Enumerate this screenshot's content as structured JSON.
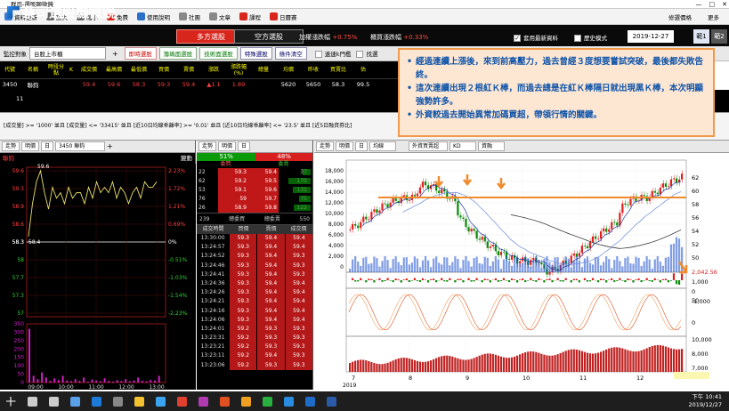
{
  "window": {
    "title": "群司-選股顯微鏡",
    "controls": [
      "—",
      "□",
      "✕"
    ]
  },
  "menu": [
    {
      "label": "資料更新",
      "icon": "refresh-icon",
      "color": "#3a7bd5"
    },
    {
      "label": "放大",
      "icon": "zoom-in-icon",
      "color": "#666666"
    },
    {
      "label": "縮小",
      "icon": "zoom-out-icon",
      "color": "#666666"
    },
    {
      "label": "免費",
      "icon": "free-badge-icon",
      "color": "#d9261c"
    },
    {
      "label": "使用說明",
      "icon": "help-icon",
      "color": "#2a6fc9"
    },
    {
      "label": "社團",
      "icon": "community-icon",
      "color": "#888888"
    },
    {
      "label": "文章",
      "icon": "article-icon",
      "color": "#888888"
    },
    {
      "label": "課程",
      "icon": "course-icon",
      "color": "#d9261c"
    },
    {
      "label": "日曆賽",
      "icon": "calendar-icon",
      "color": "#d9261c"
    }
  ],
  "menu_right": {
    "settings": "修選價格",
    "more": "更多"
  },
  "brand": {
    "name": "蔡司選股顯微鏡"
  },
  "mode_buttons": {
    "long": "多方選股",
    "short": "空方選股"
  },
  "stats": {
    "rise_label": "加權漲跌幅",
    "rise_value": "+0.75%",
    "counter_label": "櫃買漲跌幅",
    "counter_value": "+0.33%"
  },
  "options": {
    "latest_data": "套用最新資料",
    "history_mode": "歷史模式",
    "latest_checked": true,
    "history_checked": false
  },
  "date": "2019-12-27",
  "tabs": [
    "範1",
    "範2"
  ],
  "filter": {
    "label": "監控對象",
    "market": "台股上市櫃",
    "buttons": [
      {
        "label": "即時選股",
        "style": "red"
      },
      {
        "label": "籌碼面選股",
        "style": "green"
      },
      {
        "label": "技術面選股",
        "style": "green"
      },
      {
        "label": "特殊選股",
        "style": "blue"
      },
      {
        "label": "條件清空",
        "style": "blue"
      }
    ],
    "checks": [
      "速速k門檻",
      "找選"
    ]
  },
  "quote_table": {
    "headers": [
      "代號",
      "名稱",
      "時段分點",
      "K",
      "成交價",
      "最高價",
      "最低價",
      "買價",
      "賣價",
      "漲跌",
      "漲跌幅(%)",
      "總量",
      "均價",
      "昨收",
      "買賣比",
      "估"
    ],
    "row": [
      "3450",
      "聯鈞",
      "",
      "",
      "59.4",
      "59.6",
      "58.3",
      "59.3",
      "59.4",
      "▲1.1",
      "1.89",
      "",
      "5620",
      "5650",
      "58.3",
      "99.5"
    ],
    "row_count": "11"
  },
  "condition_text": "[成交量] >= '1000' 並且 [成交量] <= '33415' 並且 [近10日均線乖離率] >= '0.01' 並且 [近10日均線乖離率] <= '23.5' 並且 [近5日融資券比]",
  "left_panel": {
    "tabs": [
      "走勢",
      "明價",
      "日"
    ],
    "stock": "3450 聯鈞",
    "header_name": "聯鈞",
    "header_mode": "變動",
    "price_axis": [
      "59.6",
      "59.3",
      "58.9",
      "58.6",
      "58.3",
      "58",
      "57.7",
      "57.3",
      "57"
    ],
    "pct_axis": [
      "2.23%",
      "1.72%",
      "1.21%",
      "0.69%",
      "0%",
      "-0.51%",
      "-1.03%",
      "-1.54%",
      "-2.23%"
    ],
    "vol_axis": [
      "350",
      "300",
      "250",
      "200",
      "150",
      "100",
      "50",
      "0"
    ],
    "time_axis": [
      "09:00",
      "10:00",
      "11:00",
      "12:00",
      "13:00"
    ],
    "high_marker": "59.6",
    "low_marker": "58.4",
    "ref_price": "58.3",
    "line_color": "#e6e06a",
    "vol_color": "#d020c8"
  },
  "mid_panel": {
    "tabs": [
      "走勢",
      "明價",
      "日"
    ],
    "buy_pct": "51%",
    "sell_pct": "48%",
    "buy_label": "委買",
    "sell_label": "委賣",
    "order_book": [
      [
        "22",
        "59.3",
        "59.4",
        "37"
      ],
      [
        "62",
        "59.2",
        "59.5",
        "170"
      ],
      [
        "53",
        "59.1",
        "59.6",
        "131"
      ],
      [
        "76",
        "59",
        "59.7",
        "75"
      ],
      [
        "26",
        "58.9",
        "59.8",
        "122"
      ]
    ],
    "totals": {
      "buy_total": "239",
      "buy_label": "總委買",
      "sell_label": "總委賣",
      "sell_total": "550"
    },
    "trade_headers": [
      "成交時間",
      "買價",
      "賣價",
      "成交價"
    ],
    "trades": [
      [
        "13:30:00",
        "59.3",
        "59.4",
        "59.4"
      ],
      [
        "13:24:57",
        "59.3",
        "59.4",
        "59.4"
      ],
      [
        "13:24:52",
        "59.3",
        "59.4",
        "59.3"
      ],
      [
        "13:24:46",
        "59.3",
        "59.4",
        "59.3"
      ],
      [
        "13:24:41",
        "59.3",
        "59.4",
        "59.3"
      ],
      [
        "13:24:36",
        "59.3",
        "59.4",
        "59.4"
      ],
      [
        "13:24:26",
        "59.3",
        "59.4",
        "59.4"
      ],
      [
        "13:24:21",
        "59.3",
        "59.4",
        "59.4"
      ],
      [
        "13:24:16",
        "59.3",
        "59.4",
        "59.4"
      ],
      [
        "13:24:06",
        "59.3",
        "59.4",
        "59.4"
      ],
      [
        "13:24:01",
        "59.2",
        "59.3",
        "59.3"
      ],
      [
        "13:23:31",
        "59.2",
        "59.3",
        "59.3"
      ],
      [
        "13:23:21",
        "59.2",
        "59.3",
        "59.3"
      ],
      [
        "13:23:11",
        "59.2",
        "59.4",
        "59.3"
      ],
      [
        "13:23:06",
        "59.2",
        "59.3",
        "59.3"
      ]
    ]
  },
  "right_panel": {
    "tabs": [
      "走勢",
      "明價",
      "日"
    ],
    "selects": [
      "均線",
      "外資買賣超",
      "KD",
      "資融"
    ],
    "left_axis": [
      "18,000",
      "16,000",
      "14,000",
      "12,000",
      "10,000",
      "8,000",
      "6,000",
      "4,000",
      "2,000",
      "0"
    ],
    "right_axis": [
      "62",
      "60",
      "58",
      "56",
      "54",
      "52",
      "50"
    ],
    "foreign_axis": [
      "2,042.56",
      "1,000",
      "0",
      "-1,000"
    ],
    "kd_axis": [
      "50",
      "0"
    ],
    "margin_axis": [
      "10,000",
      "8,000",
      "7,000"
    ],
    "x_axis": [
      "7",
      "8",
      "9",
      "10",
      "11",
      "12"
    ],
    "year": "2019",
    "up_color": "#e02020",
    "down_color": "#0a8a0a",
    "bar_color": "#1a4fd0",
    "resist_color": "#f08a2a"
  },
  "annotation": [
    "經過連續上漲後，來到前高壓力，過去曾經３度想要嘗試突破，最後都失敗告終。",
    "這次連續出現２根紅Ｋ棒，而過去總是在紅Ｋ棒隔日就出現黑Ｋ棒，本次明顯強勢許多。",
    "外資較過去開始異常加碼買超，帶領行情的關鍵。"
  ],
  "taskbar": {
    "apps": [
      "start-icon",
      "search-icon",
      "task-view-icon",
      "store-icon",
      "teamviewer-icon",
      "calculator-icon",
      "explorer-icon",
      "mail-icon",
      "chrome-icon",
      "paint-icon",
      "camera-icon",
      "shopping-icon",
      "line-icon",
      "edge-icon",
      "ie-icon",
      "word-icon"
    ],
    "colors": [
      "#ffffff",
      "#cccccc",
      "#cccccc",
      "#5aa0e8",
      "#1e7ad8",
      "#888888",
      "#f2c230",
      "#3aa4f0",
      "#e04030",
      "#b03ab0",
      "#e05020",
      "#f0a020",
      "#2ab040",
      "#2a8ce0",
      "#1e6cc8",
      "#2b5aa8"
    ],
    "time": "下午 10:41",
    "date": "2019/12/27"
  }
}
